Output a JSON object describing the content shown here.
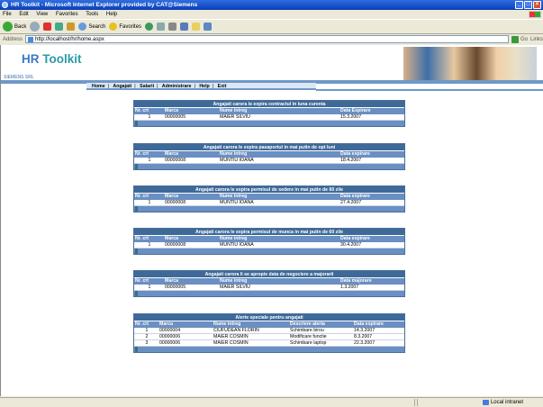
{
  "window": {
    "title": "HR Toolkit - Microsoft Internet Explorer provided by CAT@Siemens",
    "minimize": "_",
    "maximize": "□",
    "close": "×"
  },
  "menu": [
    "File",
    "Edit",
    "View",
    "Favorites",
    "Tools",
    "Help"
  ],
  "toolbar": {
    "back": "Back",
    "search": "Search",
    "favorites": "Favorites"
  },
  "address": {
    "label": "Address",
    "url": "http://localhost/hr/home.aspx",
    "go": "Go",
    "links": "Links"
  },
  "header": {
    "logo_hr": "HR",
    "logo_toolkit": "Toolkit",
    "company": "SIEMENS SRL"
  },
  "nav": [
    "Home",
    "Angajati",
    "Salarii",
    "Administrare",
    "Help",
    "Exit"
  ],
  "tables": [
    {
      "title": "Angajati carora le expira contractul in luna curenta",
      "columns": [
        "Nr. crt",
        "Marca",
        "Nume intreg",
        "Data Expirare"
      ],
      "rows": [
        [
          "1",
          "00000005",
          "MAIER SILVIU",
          "15.3.2007"
        ]
      ]
    },
    {
      "title": "Angajati carora le expira pasaportul in mai putin de opt luni",
      "columns": [
        "Nr. crt",
        "Marca",
        "Nume intreg",
        "Data expirare"
      ],
      "rows": [
        [
          "1",
          "00000008",
          "MUNTIU IOANA",
          "18.4.2007"
        ]
      ]
    },
    {
      "title": "Angajati carora le expira permisul de sedere in mai putin de 60 zile",
      "columns": [
        "Nr. crt",
        "Marca",
        "Nume intreg",
        "Data expirare"
      ],
      "rows": [
        [
          "1",
          "00000008",
          "MUNTIU IOANA",
          "27.4.2007"
        ]
      ]
    },
    {
      "title": "Angajati carora le expira permisul de munca in mai putin de 60 zile",
      "columns": [
        "Nr. crt",
        "Marca",
        "Nume intreg",
        "Data expirare"
      ],
      "rows": [
        [
          "1",
          "00000008",
          "MUNTIU IOANA",
          "30.4.2007"
        ]
      ]
    },
    {
      "title": "Angajati carora li se apropie data de negociere a majorarii",
      "columns": [
        "Nr. crt",
        "Marca",
        "Nume intreg",
        "Data majorare"
      ],
      "rows": [
        [
          "1",
          "00000005",
          "MAIER SILVIU",
          "1.3.2007"
        ]
      ]
    },
    {
      "title": "Alerte speciale pentru angajati",
      "columns": [
        "Nr. crt",
        "Marca",
        "Nume intreg",
        "Descriere alerta",
        "Data expirare"
      ],
      "rows": [
        [
          "1",
          "00000004",
          "CIUFUDEAN FLORIN",
          "Schimbare birou",
          "14.3.2007"
        ],
        [
          "2",
          "00000006",
          "MAIER COSMIN",
          "Modificare functie",
          "8.3.2007"
        ],
        [
          "3",
          "00000006",
          "MAIER COSMIN",
          "Schimbare laptop",
          "22.3.2007"
        ]
      ]
    }
  ],
  "status": {
    "zone": "Local intranet"
  }
}
